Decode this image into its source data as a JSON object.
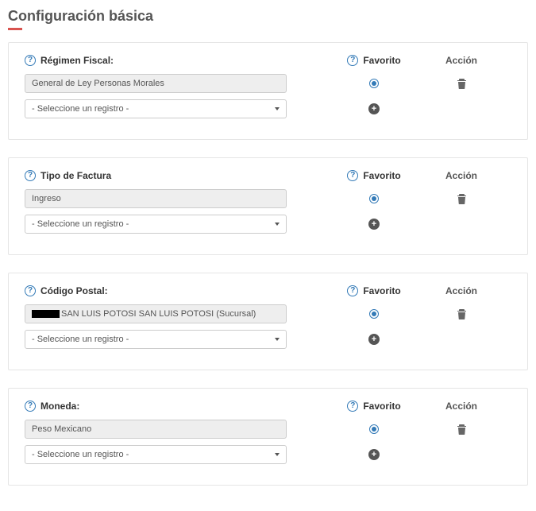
{
  "page": {
    "title": "Configuración básica"
  },
  "columns": {
    "favorite": "Favorito",
    "action": "Acción"
  },
  "common": {
    "select_placeholder": "- Seleccione un registro -"
  },
  "sections": [
    {
      "label": "Régimen Fiscal:",
      "value": "General de Ley Personas Morales",
      "redacted_prefix": false
    },
    {
      "label": "Tipo de Factura",
      "value": "Ingreso",
      "redacted_prefix": false
    },
    {
      "label": "Código Postal:",
      "value": "SAN LUIS POTOSI SAN LUIS POTOSI (Sucursal)",
      "redacted_prefix": true
    },
    {
      "label": "Moneda:",
      "value": "Peso Mexicano",
      "redacted_prefix": false
    }
  ]
}
